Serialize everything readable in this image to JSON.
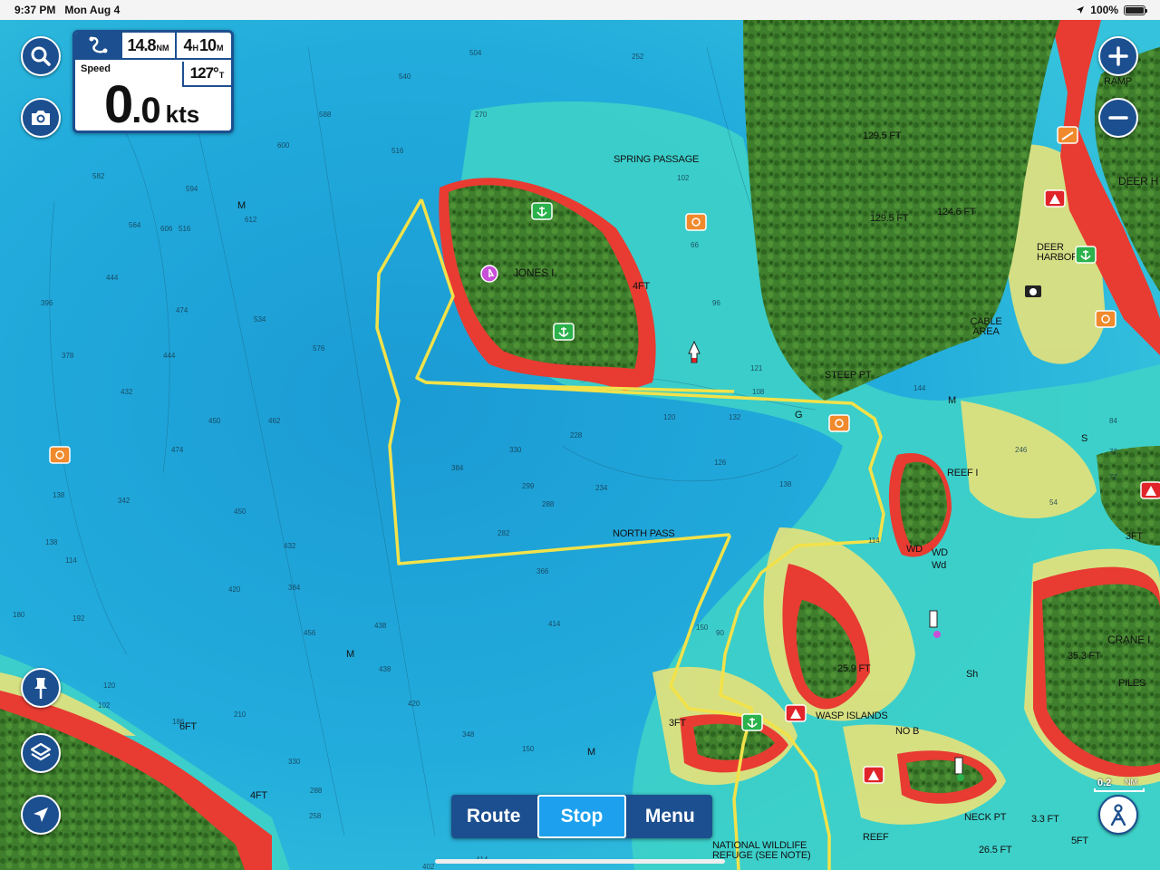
{
  "status_bar": {
    "time": "9:37 PM",
    "date": "Mon Aug 4",
    "battery": "100%",
    "battery_level_pct": 100
  },
  "instruments": {
    "route_icon": "route-icon",
    "distance_value": "14.8",
    "distance_unit": "NM",
    "ttg_hours": "4",
    "ttg_h_unit": "H",
    "ttg_minutes": "10",
    "ttg_m_unit": "M",
    "speed_label": "Speed",
    "speed_int": "0",
    "speed_dec": ".0",
    "speed_unit": "kts",
    "heading_value": "127°",
    "heading_ref": "T"
  },
  "controls": {
    "search_icon": "search-icon",
    "camera_icon": "camera-icon",
    "pin_icon": "pin-icon",
    "layers_icon": "layers-icon",
    "locate_icon": "navigation-arrow-icon",
    "zoom_in_icon": "plus-icon",
    "zoom_out_icon": "minus-icon",
    "profile_icon": "boater-profile-icon"
  },
  "nav": {
    "route": "Route",
    "stop": "Stop",
    "menu": "Menu"
  },
  "scale": {
    "value": "0.2",
    "unit": "NM"
  },
  "map_labels": {
    "spring_passage": "SPRING PASSAGE",
    "jones_island": "JONES I",
    "jones_depth": "4FT",
    "north_pass": "NORTH PASS",
    "steep_pt": "STEEP PT",
    "cable_area": "CABLE AREA",
    "deer_harbor": "DEER HARBOR",
    "deer": "DEER H",
    "ramp": "RAMP",
    "reef_i": "REEF I",
    "crane_i": "CRANE I",
    "wasp_islands": "WASP ISLANDS",
    "neck_pt": "NECK PT",
    "piles": "PILES",
    "no_b": "NO B",
    "reef": "REEF",
    "wd1": "WD",
    "wd2": "WD",
    "wd3": "Wd",
    "sh": "Sh",
    "m1": "M",
    "m2": "M",
    "m3": "M",
    "m4": "M",
    "g": "G",
    "s": "S",
    "elev_1": "129.5 FT",
    "elev_2": "129.5 FT",
    "elev_3": "124.6 FT",
    "elev_4": "35.3 FT",
    "elev_5": "25.9 FT",
    "elev_6": "26.5 FT",
    "elev_7": "3.3 FT",
    "ft_1": "3FT",
    "ft_2": "3FT",
    "ft_3": "6FT",
    "ft_4": "4FT",
    "ft_5": "5FT",
    "national_wildlife": "NATIONAL WILDLIFE REFUGE (SEE NOTE)"
  },
  "soundings": [
    "540",
    "504",
    "252",
    "588",
    "600",
    "516",
    "582",
    "594",
    "612",
    "606",
    "564",
    "516",
    "444",
    "474",
    "534",
    "396",
    "378",
    "432",
    "444",
    "576",
    "450",
    "462",
    "474",
    "330",
    "228",
    "120",
    "132",
    "126",
    "138",
    "384",
    "299",
    "234",
    "288",
    "282",
    "342",
    "450",
    "432",
    "420",
    "384",
    "414",
    "456",
    "438",
    "438",
    "420",
    "348",
    "150",
    "366",
    "90",
    "114",
    "121",
    "108",
    "102",
    "96",
    "144",
    "246",
    "192",
    "138",
    "114",
    "102",
    "210",
    "72",
    "84",
    "54",
    "72",
    "270",
    "138",
    "180",
    "120",
    "186",
    "150",
    "66",
    "330",
    "288",
    "258",
    "264",
    "414",
    "402"
  ],
  "colors": {
    "ui_blue": "#1c4f8f",
    "active_blue": "#1da1ef",
    "track_yellow": "#f2e24a",
    "deep_water": "#1fa6d8",
    "shallow_water": "#3fd3c7",
    "very_shallow": "#e7e27a",
    "danger_red": "#e83b32",
    "land_green": "#3e7e2c"
  }
}
